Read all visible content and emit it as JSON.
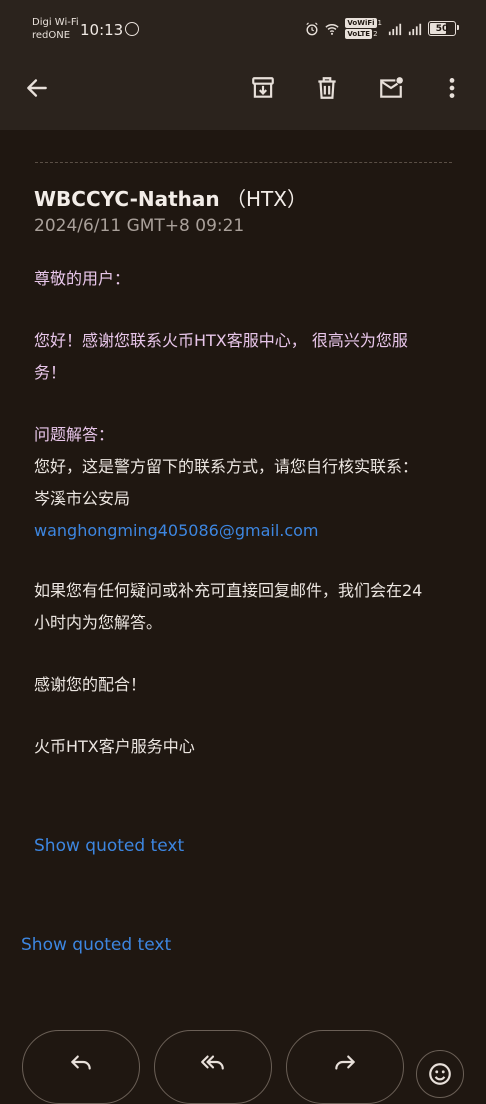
{
  "status_bar": {
    "carrier_line1": "Digi Wi-Fi",
    "carrier_line2": "redONE",
    "time": "10:13",
    "volte_1": "VoWiFi",
    "volte_2": "VoLTE",
    "sim1": "1",
    "sim2": "2",
    "battery": "50"
  },
  "toolbar": {
    "icons": [
      "back-arrow-icon",
      "archive-icon",
      "delete-icon",
      "mark-unread-icon",
      "more-vert-icon"
    ]
  },
  "email": {
    "sender_name": "WBCCYC-Nathan",
    "sender_org": "（HTX）",
    "date": "2024/6/11 GMT+8 09:21",
    "greeting": "尊敬的用户：",
    "intro_line1": "您好！感谢您联系火币HTX客服中心， 很高兴为您服",
    "intro_line2": "务！",
    "answer_heading": "问题解答：",
    "answer_line1": "您好，这是警方留下的联系方式，请您自行核实联系：",
    "answer_line2": "岑溪市公安局",
    "email_link": "wanghongming405086@gmail.com",
    "followup_line1": "如果您有任何疑问或补充可直接回复邮件，我们会在24",
    "followup_line2": "小时内为您解答。",
    "thanks": "感谢您的配合！",
    "signature": "火币HTX客户服务中心",
    "show_quoted_inner": "Show quoted text",
    "show_quoted_outer": "Show quoted text"
  },
  "actions": {
    "icons": [
      "reply-icon",
      "reply-all-icon",
      "forward-icon",
      "emoji-icon"
    ]
  },
  "colors": {
    "background": "#1f1711",
    "toolbar": "#2b231d",
    "link": "#3d86e0",
    "pink_text": "#e8c6ea"
  }
}
